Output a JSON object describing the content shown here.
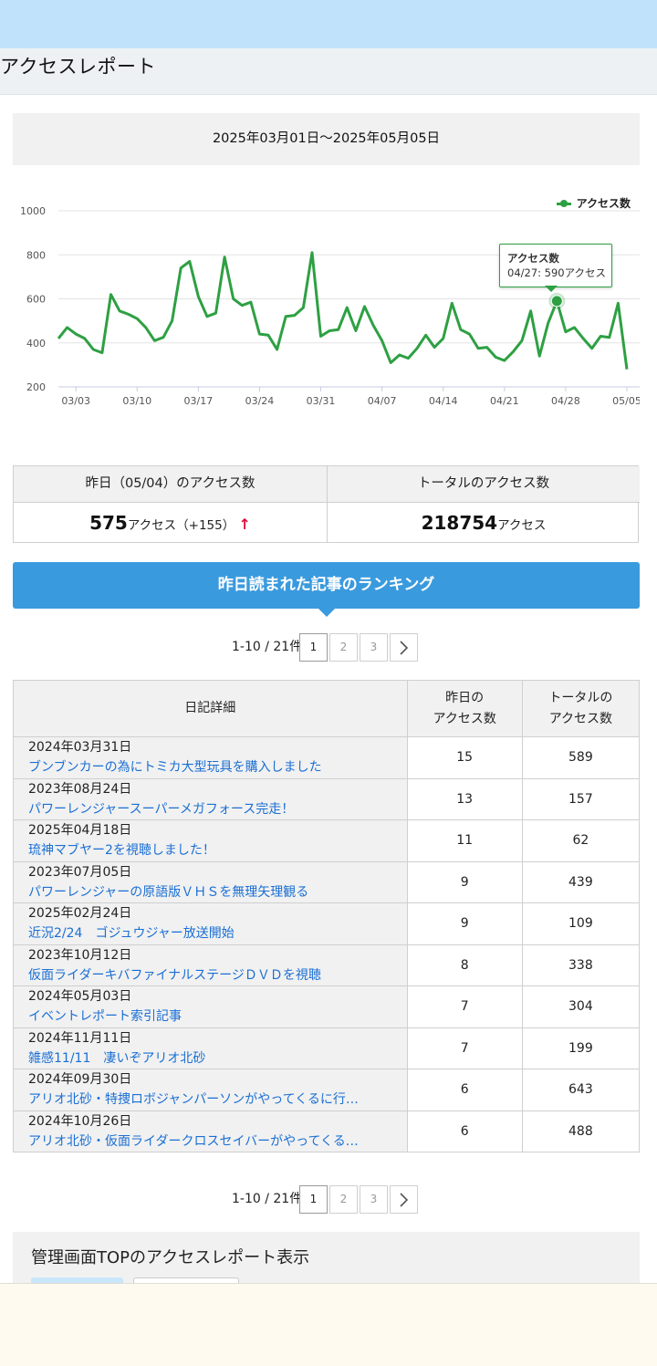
{
  "page": {
    "title": "アクセスレポート",
    "date_range": "2025年03月01日〜2025年05月05日"
  },
  "chart_data": {
    "type": "line",
    "series": [
      {
        "name": "アクセス数",
        "color": "#2ea043",
        "values": [
          420,
          470,
          440,
          420,
          370,
          355,
          620,
          545,
          530,
          510,
          470,
          410,
          425,
          500,
          740,
          770,
          610,
          520,
          535,
          790,
          600,
          570,
          585,
          440,
          435,
          370,
          520,
          525,
          560,
          810,
          430,
          455,
          460,
          560,
          455,
          565,
          480,
          410,
          310,
          345,
          330,
          375,
          435,
          380,
          420,
          580,
          460,
          440,
          375,
          380,
          335,
          320,
          360,
          410,
          545,
          340,
          490,
          590,
          450,
          470,
          420,
          375,
          430,
          425,
          580,
          280
        ]
      }
    ],
    "x_tick_labels": [
      "03/03",
      "03/10",
      "03/17",
      "03/24",
      "03/31",
      "04/07",
      "04/14",
      "04/21",
      "04/28",
      "05/05"
    ],
    "x_tick_index": [
      2,
      9,
      16,
      23,
      30,
      37,
      44,
      51,
      58,
      65
    ],
    "y_ticks": [
      200,
      400,
      600,
      800,
      1000
    ],
    "ylim": [
      200,
      1000
    ],
    "grid": "horizontal",
    "legend_position": "top-right",
    "tooltip": {
      "title": "アクセス数",
      "text": "04/27: 590アクセス",
      "index": 57
    }
  },
  "stats": {
    "yesterday_header": "昨日（05/04）のアクセス数",
    "total_header": "トータルのアクセス数",
    "yesterday_count": "575",
    "yesterday_unit": "アクセス（+155）",
    "up_icon": "↑",
    "total_count": "218754",
    "total_unit": "アクセス"
  },
  "ranking": {
    "title": "昨日読まれた記事のランキング",
    "pager_info": "1-10 / 21件",
    "pages": [
      "1",
      "2",
      "3"
    ],
    "next_icon": "chevron-right",
    "headers": {
      "detail": "日記詳細",
      "yesterday": "昨日の\nアクセス数",
      "total": "トータルの\nアクセス数"
    },
    "rows": [
      {
        "date": "2024年03月31日",
        "title": "ブンブンカーの為にトミカ大型玩具を購入しました",
        "yesterday": "15",
        "total": "589"
      },
      {
        "date": "2023年08月24日",
        "title": "パワーレンジャースーパーメガフォース完走！",
        "yesterday": "13",
        "total": "157"
      },
      {
        "date": "2025年04月18日",
        "title": "琉神マブヤー2を視聴しました！",
        "yesterday": "11",
        "total": "62"
      },
      {
        "date": "2023年07月05日",
        "title": "パワーレンジャーの原語版ＶＨＳを無理矢理観る",
        "yesterday": "9",
        "total": "439"
      },
      {
        "date": "2025年02月24日",
        "title": "近況2/24　ゴジュウジャー放送開始",
        "yesterday": "9",
        "total": "109"
      },
      {
        "date": "2023年10月12日",
        "title": "仮面ライダーキバファイナルステージＤＶＤを視聴",
        "yesterday": "8",
        "total": "338"
      },
      {
        "date": "2024年05月03日",
        "title": "イベントレポート索引記事",
        "yesterday": "7",
        "total": "304"
      },
      {
        "date": "2024年11月11日",
        "title": "雑感11/11　凄いぞアリオ北砂",
        "yesterday": "7",
        "total": "199"
      },
      {
        "date": "2024年09月30日",
        "title": "アリオ北砂・特捜ロボジャンパーソンがやってくるに行…",
        "yesterday": "6",
        "total": "643"
      },
      {
        "date": "2024年10月26日",
        "title": "アリオ北砂・仮面ライダークロスセイバーがやってくる…",
        "yesterday": "6",
        "total": "488"
      }
    ]
  },
  "management": {
    "title": "管理画面TOPのアクセスレポート表示"
  }
}
